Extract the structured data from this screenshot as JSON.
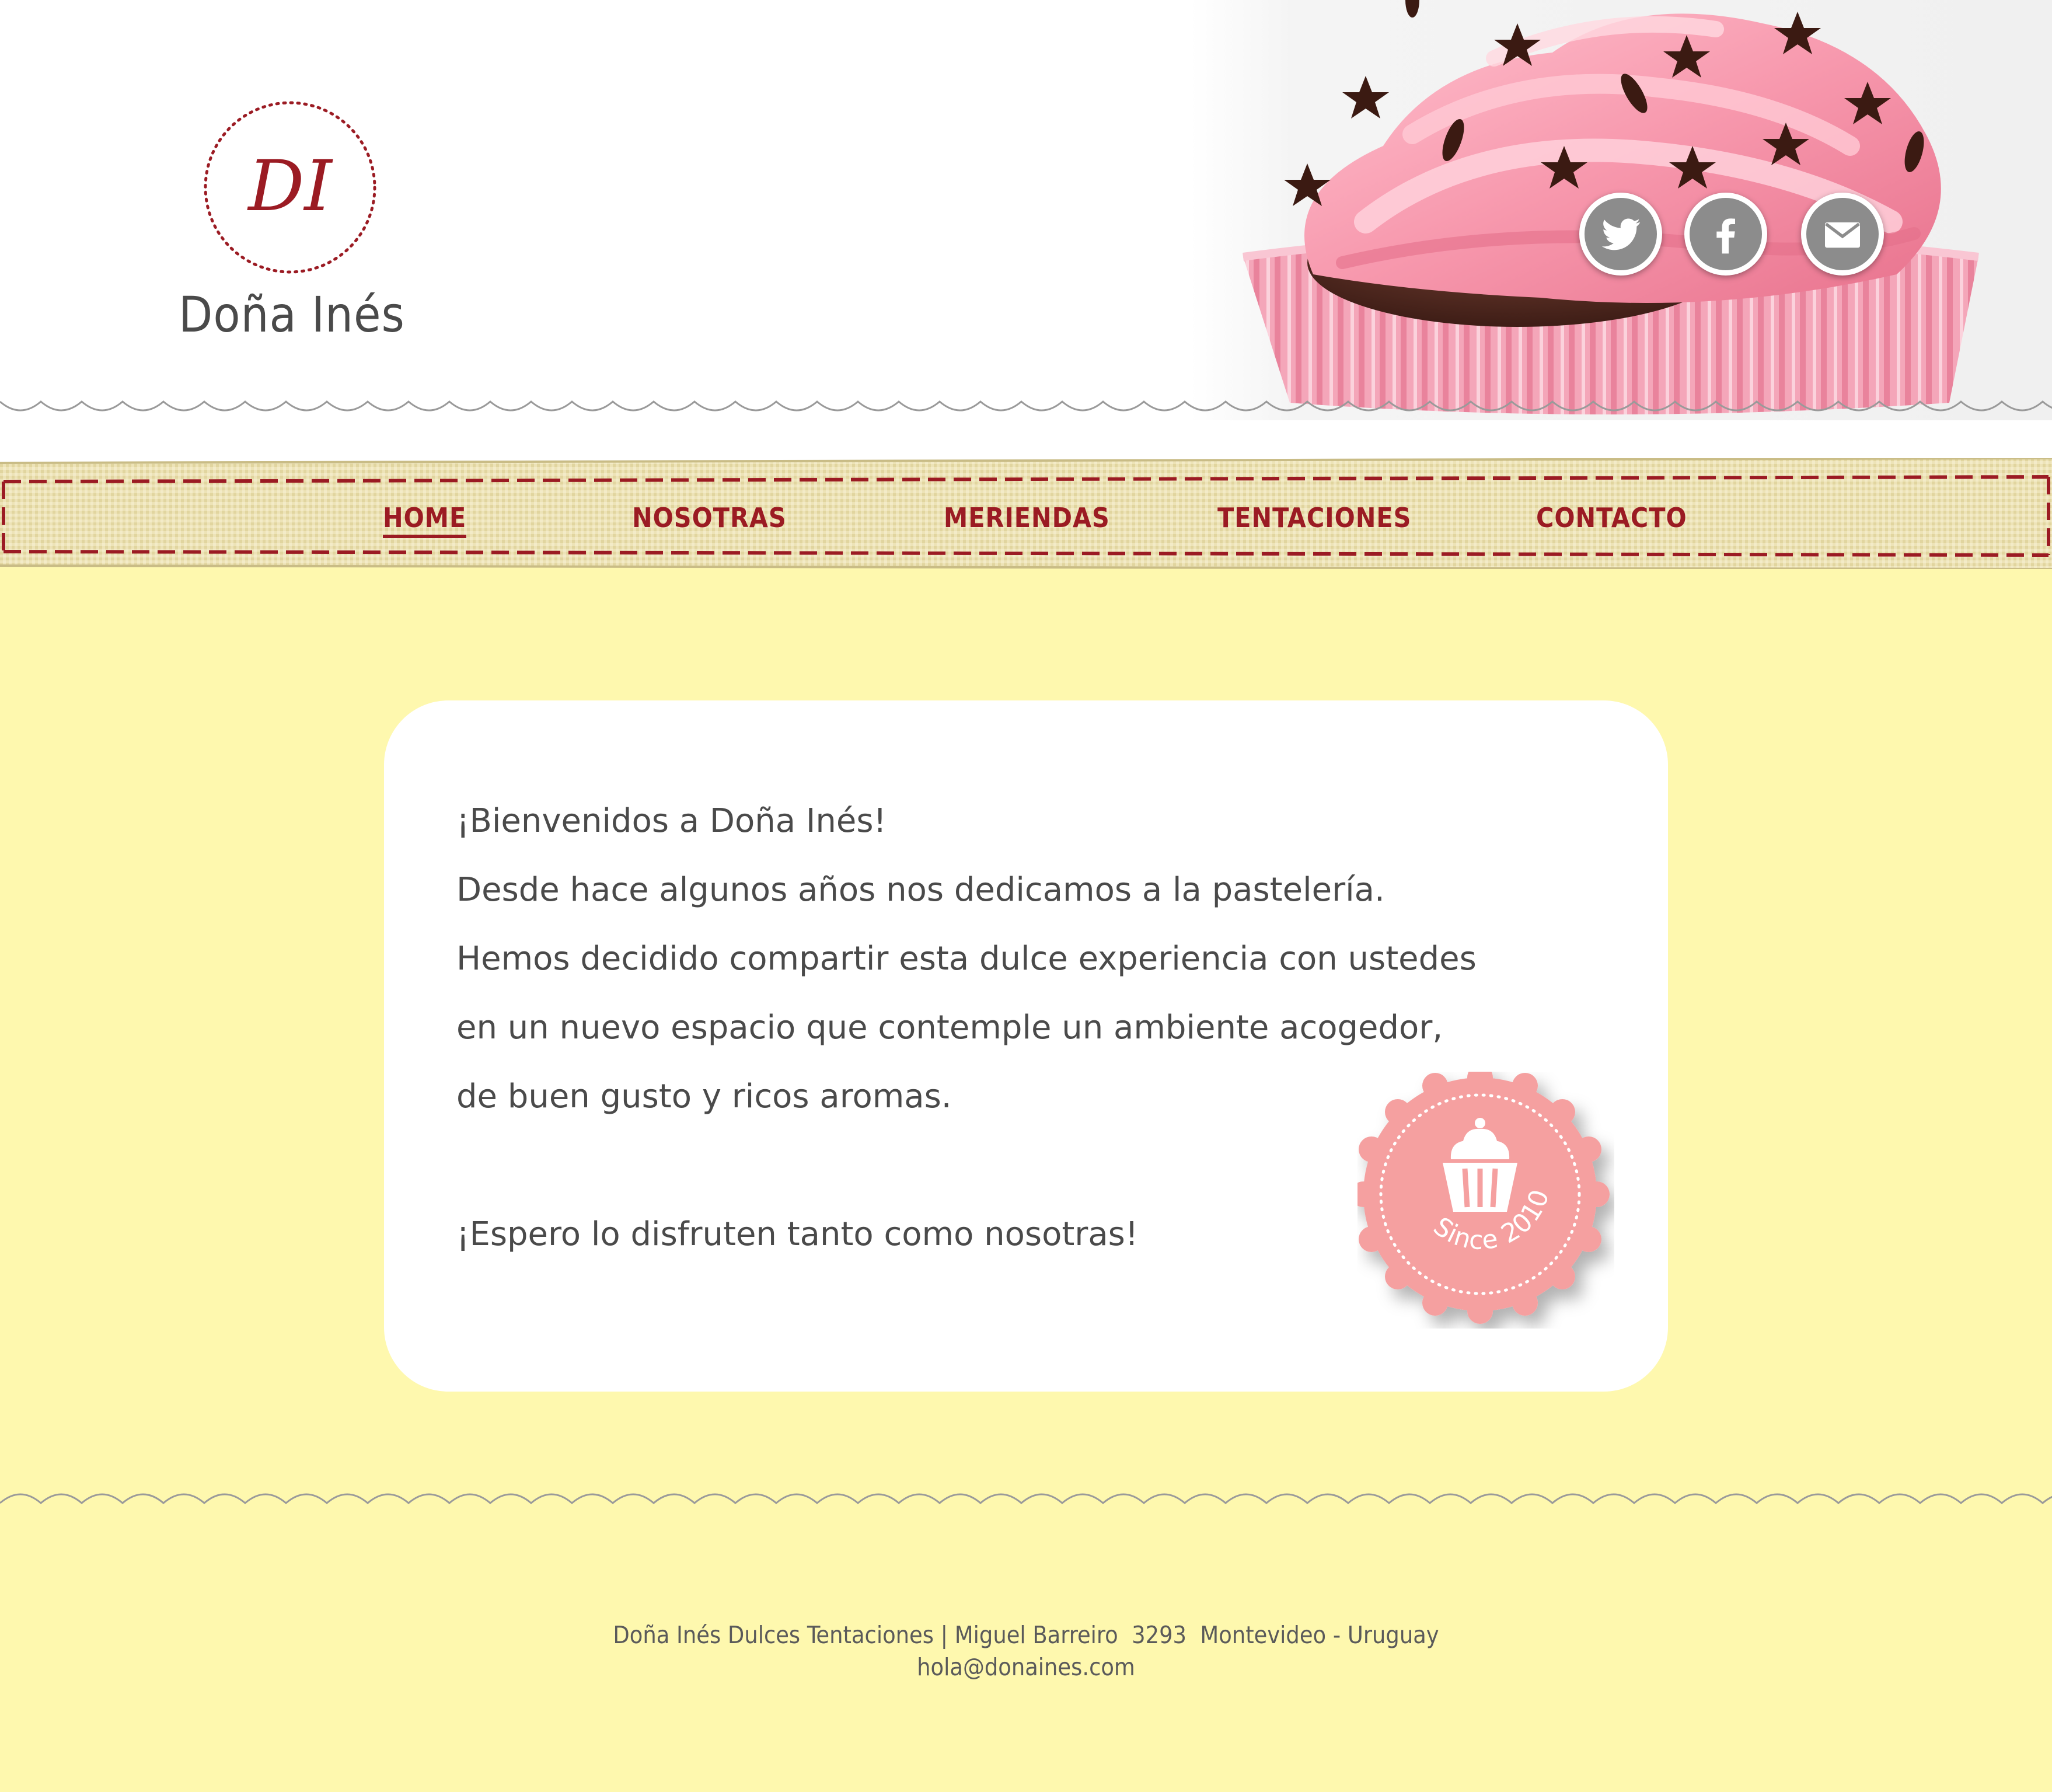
{
  "brand": {
    "monogram": "DI",
    "name": "Doña Inés"
  },
  "social": [
    {
      "name": "twitter-icon"
    },
    {
      "name": "facebook-icon"
    },
    {
      "name": "mail-icon"
    }
  ],
  "nav": {
    "items": [
      {
        "label": "HOME",
        "active": true
      },
      {
        "label": "NOSOTRAS",
        "active": false
      },
      {
        "label": "MERIENDAS",
        "active": false
      },
      {
        "label": "TENTACIONES",
        "active": false
      },
      {
        "label": "CONTACTO",
        "active": false
      }
    ]
  },
  "welcome": {
    "lines": [
      "¡Bienvenidos a Doña Inés!",
      "Desde hace algunos años nos dedicamos a la pastelería.",
      "Hemos decidido compartir esta dulce experiencia con ustedes",
      "en un nuevo espacio que contemple un ambiente acogedor,",
      "de buen gusto y ricos aromas."
    ],
    "closing": "¡Espero lo disfruten tanto como nosotras!"
  },
  "badge": {
    "text": "Since 2010",
    "icon": "cupcake-icon"
  },
  "footer": {
    "address": "Doña Inés Dulces Tentaciones | Miguel Barreiro  3293  Montevideo - Uruguay",
    "email": "hola@donaines.com"
  },
  "colors": {
    "background_main": "#fef8ae",
    "accent_red": "#9b1b23",
    "frosting_pink": "#f7a0b0",
    "badge_pink": "#f5a0a0",
    "icon_gray": "#8c8c8c",
    "ribbon_tan": "#ede3b7"
  }
}
